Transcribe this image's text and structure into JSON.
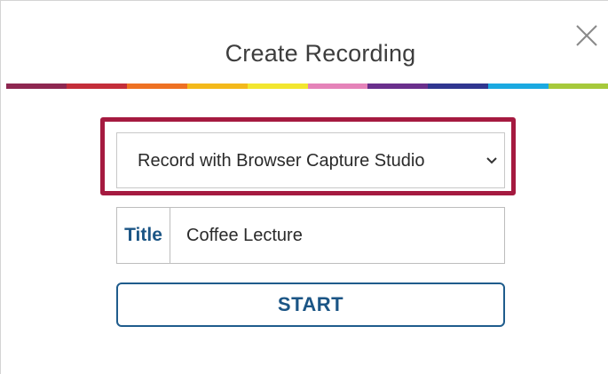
{
  "dialog": {
    "title": "Create Recording",
    "close_icon": "close-icon"
  },
  "color_bar": [
    "#8e2751",
    "#c42e3a",
    "#ee7123",
    "#f3b91b",
    "#f2e62f",
    "#e583b9",
    "#6a2f8c",
    "#303690",
    "#1ba9e1",
    "#a6c93b"
  ],
  "recording_source": {
    "selected": "Record with Browser Capture Studio",
    "chevron_icon": "chevron-down-icon",
    "highlight_color": "#a51a40"
  },
  "title_field": {
    "label": "Title",
    "value": "Coffee Lecture"
  },
  "start_button": {
    "label": "START"
  },
  "colors": {
    "accent": "#1b5585",
    "text": "#3d3d3d"
  }
}
